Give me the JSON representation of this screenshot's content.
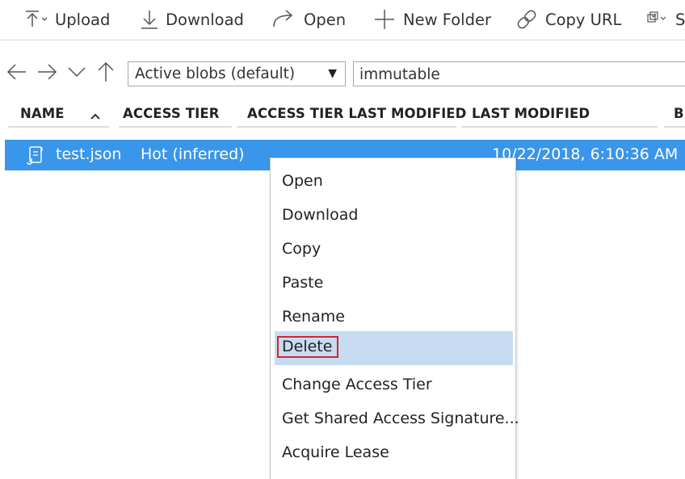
{
  "toolbar": {
    "upload": {
      "label": "Upload",
      "icon": "upload-icon"
    },
    "download": {
      "label": "Download",
      "icon": "download-icon"
    },
    "open": {
      "label": "Open",
      "icon": "open-icon"
    },
    "new_folder": {
      "label": "New Folder",
      "icon": "plus-icon"
    },
    "copy_url": {
      "label": "Copy URL",
      "icon": "link-icon"
    },
    "select": {
      "label": "S",
      "icon": "select-all-icon"
    }
  },
  "nav": {
    "back_icon": "arrow-left-icon",
    "forward_icon": "arrow-right-icon",
    "recent_icon": "chevron-down-icon",
    "up_icon": "arrow-up-icon"
  },
  "filter": {
    "selected": "Active blobs (default)"
  },
  "search": {
    "value": "immutable"
  },
  "columns": [
    {
      "label": "NAME"
    },
    {
      "label": "ACCESS TIER"
    },
    {
      "label": "ACCESS TIER LAST MODIFIED"
    },
    {
      "label": "LAST MODIFIED"
    },
    {
      "label": "BL"
    }
  ],
  "rows": [
    {
      "name": "test.json",
      "access_tier": "Hot (inferred)",
      "last_modified": "10/22/2018, 6:10:36 AM",
      "selected": true
    }
  ],
  "colors": {
    "selected_row": "#3a96ea",
    "menu_highlight": "#c7dcf2",
    "highlight_outline": "#d0262e"
  },
  "context_menu": {
    "items": [
      {
        "label": "Open"
      },
      {
        "label": "Download"
      },
      {
        "label": "Copy"
      },
      {
        "label": "Paste"
      },
      {
        "label": "Rename"
      },
      {
        "label": "Delete",
        "highlighted": true
      },
      {
        "label": "Change Access Tier"
      },
      {
        "label": "Get Shared Access Signature..."
      },
      {
        "label": "Acquire Lease"
      }
    ]
  }
}
